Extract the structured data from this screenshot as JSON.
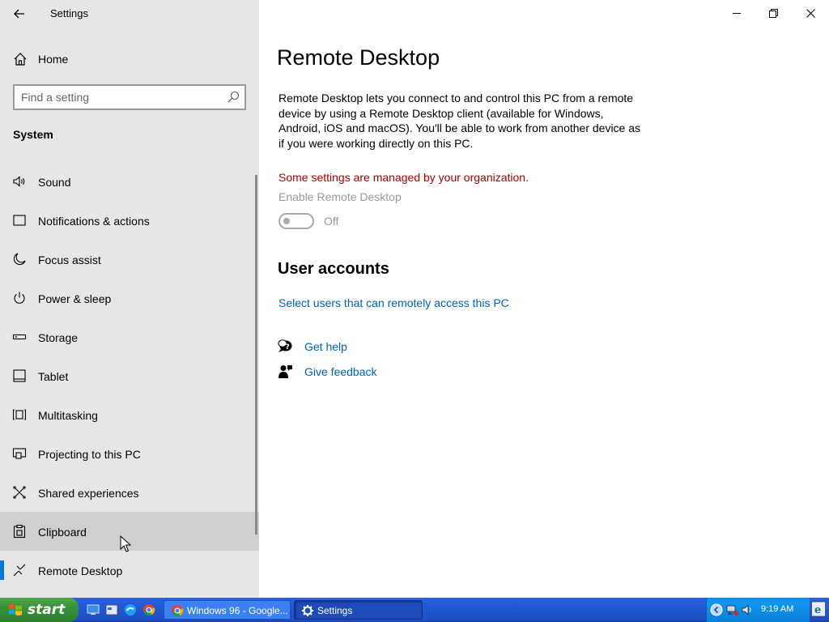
{
  "window": {
    "app_title": "Settings"
  },
  "sidebar": {
    "home_label": "Home",
    "search_placeholder": "Find a setting",
    "section_title": "System",
    "items": [
      {
        "label": "Sound",
        "icon": "speaker-icon"
      },
      {
        "label": "Notifications & actions",
        "icon": "notification-icon"
      },
      {
        "label": "Focus assist",
        "icon": "moon-icon"
      },
      {
        "label": "Power & sleep",
        "icon": "power-icon"
      },
      {
        "label": "Storage",
        "icon": "storage-icon"
      },
      {
        "label": "Tablet",
        "icon": "tablet-icon"
      },
      {
        "label": "Multitasking",
        "icon": "multitasking-icon"
      },
      {
        "label": "Projecting to this PC",
        "icon": "projecting-icon"
      },
      {
        "label": "Shared experiences",
        "icon": "shared-icon"
      },
      {
        "label": "Clipboard",
        "icon": "clipboard-icon"
      },
      {
        "label": "Remote Desktop",
        "icon": "remote-desktop-icon"
      }
    ],
    "hovered_item": "Clipboard",
    "active_item": "Remote Desktop"
  },
  "main": {
    "page_title": "Remote Desktop",
    "description": "Remote Desktop lets you connect to and control this PC from a remote device by using a Remote Desktop client (available for Windows, Android, iOS and macOS). You'll be able to work from another device as if you were working directly on this PC.",
    "managed_warning": "Some settings are managed by your organization.",
    "toggle_label": "Enable Remote Desktop",
    "toggle_state": "Off",
    "user_accounts_heading": "User accounts",
    "select_users_link": "Select users that can remotely access this PC",
    "get_help": "Get help",
    "give_feedback": "Give feedback"
  },
  "taskbar": {
    "start_label": "start",
    "tasks": [
      {
        "label": "Windows 96 - Google...",
        "icon": "chrome-icon"
      },
      {
        "label": "Settings",
        "icon": "gear-icon"
      }
    ],
    "clock": "9:19 AM"
  },
  "colors": {
    "accent": "#0078d7",
    "link": "#0063b1",
    "warning": "#a80000",
    "sidebar_bg": "#e6e6e6"
  }
}
